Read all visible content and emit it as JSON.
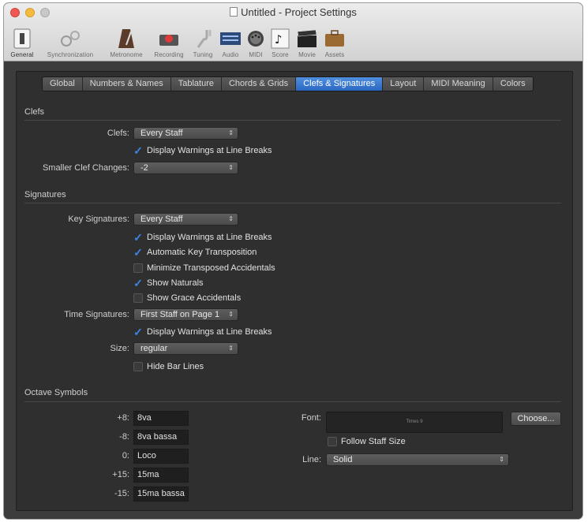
{
  "window": {
    "title": "Untitled - Project Settings"
  },
  "toolbar": [
    {
      "label": "General",
      "icon": "general-icon"
    },
    {
      "label": "Synchronization",
      "icon": "synchronization-icon"
    },
    {
      "label": "Metronome",
      "icon": "metronome-icon"
    },
    {
      "label": "Recording",
      "icon": "recording-icon"
    },
    {
      "label": "Tuning",
      "icon": "tuning-icon"
    },
    {
      "label": "Audio",
      "icon": "audio-icon"
    },
    {
      "label": "MIDI",
      "icon": "midi-icon"
    },
    {
      "label": "Score",
      "icon": "score-icon"
    },
    {
      "label": "Movie",
      "icon": "movie-icon"
    },
    {
      "label": "Assets",
      "icon": "assets-icon"
    }
  ],
  "tabs": [
    {
      "label": "Global"
    },
    {
      "label": "Numbers & Names"
    },
    {
      "label": "Tablature"
    },
    {
      "label": "Chords & Grids"
    },
    {
      "label": "Clefs & Signatures",
      "selected": true
    },
    {
      "label": "Layout"
    },
    {
      "label": "MIDI Meaning"
    },
    {
      "label": "Colors"
    }
  ],
  "clefs": {
    "title": "Clefs",
    "clefs_label": "Clefs:",
    "clefs_value": "Every Staff",
    "warnings_label": "Display Warnings at Line Breaks",
    "smaller_label": "Smaller Clef Changes:",
    "smaller_value": "-2"
  },
  "signatures": {
    "title": "Signatures",
    "key_label": "Key Signatures:",
    "key_value": "Every Staff",
    "key_checks": [
      {
        "label": "Display Warnings at Line Breaks",
        "checked": true
      },
      {
        "label": "Automatic Key Transposition",
        "checked": true
      },
      {
        "label": "Minimize Transposed Accidentals",
        "checked": false
      },
      {
        "label": "Show Naturals",
        "checked": true
      },
      {
        "label": "Show Grace Accidentals",
        "checked": false
      }
    ],
    "time_label": "Time Signatures:",
    "time_value": "First Staff on Page 1",
    "time_warnings_label": "Display Warnings at Line Breaks",
    "size_label": "Size:",
    "size_value": "regular",
    "hide_bar_label": "Hide Bar Lines"
  },
  "octave": {
    "title": "Octave Symbols",
    "rows": [
      {
        "label": "+8:",
        "value": "8va"
      },
      {
        "label": "-8:",
        "value": "8va bassa"
      },
      {
        "label": "0:",
        "value": "Loco"
      },
      {
        "label": "+15:",
        "value": "15ma"
      },
      {
        "label": "-15:",
        "value": "15ma bassa"
      }
    ],
    "font_label": "Font:",
    "font_preview": "Times 9",
    "choose_label": "Choose...",
    "follow_label": "Follow Staff Size",
    "line_label": "Line:",
    "line_value": "Solid"
  },
  "colors": {
    "accent": "#2b67c2",
    "check": "#3b86e8"
  }
}
